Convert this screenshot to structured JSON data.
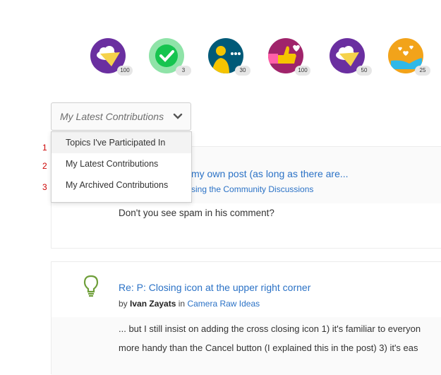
{
  "badges": [
    {
      "icon": "paper-plane-cloud-icon",
      "count": "100",
      "color": "#6a2fa0"
    },
    {
      "icon": "checkmark-icon",
      "count": "3",
      "color": "#3fcf6a"
    },
    {
      "icon": "person-chat-icon",
      "count": "30",
      "color": "#005a78"
    },
    {
      "icon": "thumbs-up-heart-icon",
      "count": "100",
      "color": "#a0246b"
    },
    {
      "icon": "paper-plane-cloud-icon",
      "count": "50",
      "color": "#6a2fa0"
    },
    {
      "icon": "hand-hearts-icon",
      "count": "25",
      "color": "#f2a31a"
    }
  ],
  "dropdown": {
    "selected": "My Latest Contributions",
    "options": [
      "Topics I've Participated In",
      "My Latest Contributions",
      "My Archived Contributions"
    ]
  },
  "annotations": [
    "1",
    "2",
    "3"
  ],
  "posts": [
    {
      "title": "my own post (as long as there are...",
      "meta_in": "sing the Community Discussions",
      "body": "Don't you see spam in his comment?"
    },
    {
      "title": "Re: P: Closing icon at the upper right corner",
      "meta_by": "by",
      "author": "Ivan Zayats",
      "meta_in_word": "in",
      "board": "Camera Raw Ideas",
      "body_line1": "... but I still insist on adding the  cross closing icon 1) it's familiar to everyon",
      "body_line2": "more handy than the Cancel button (I explained this in the post) 3) it's eas"
    }
  ]
}
